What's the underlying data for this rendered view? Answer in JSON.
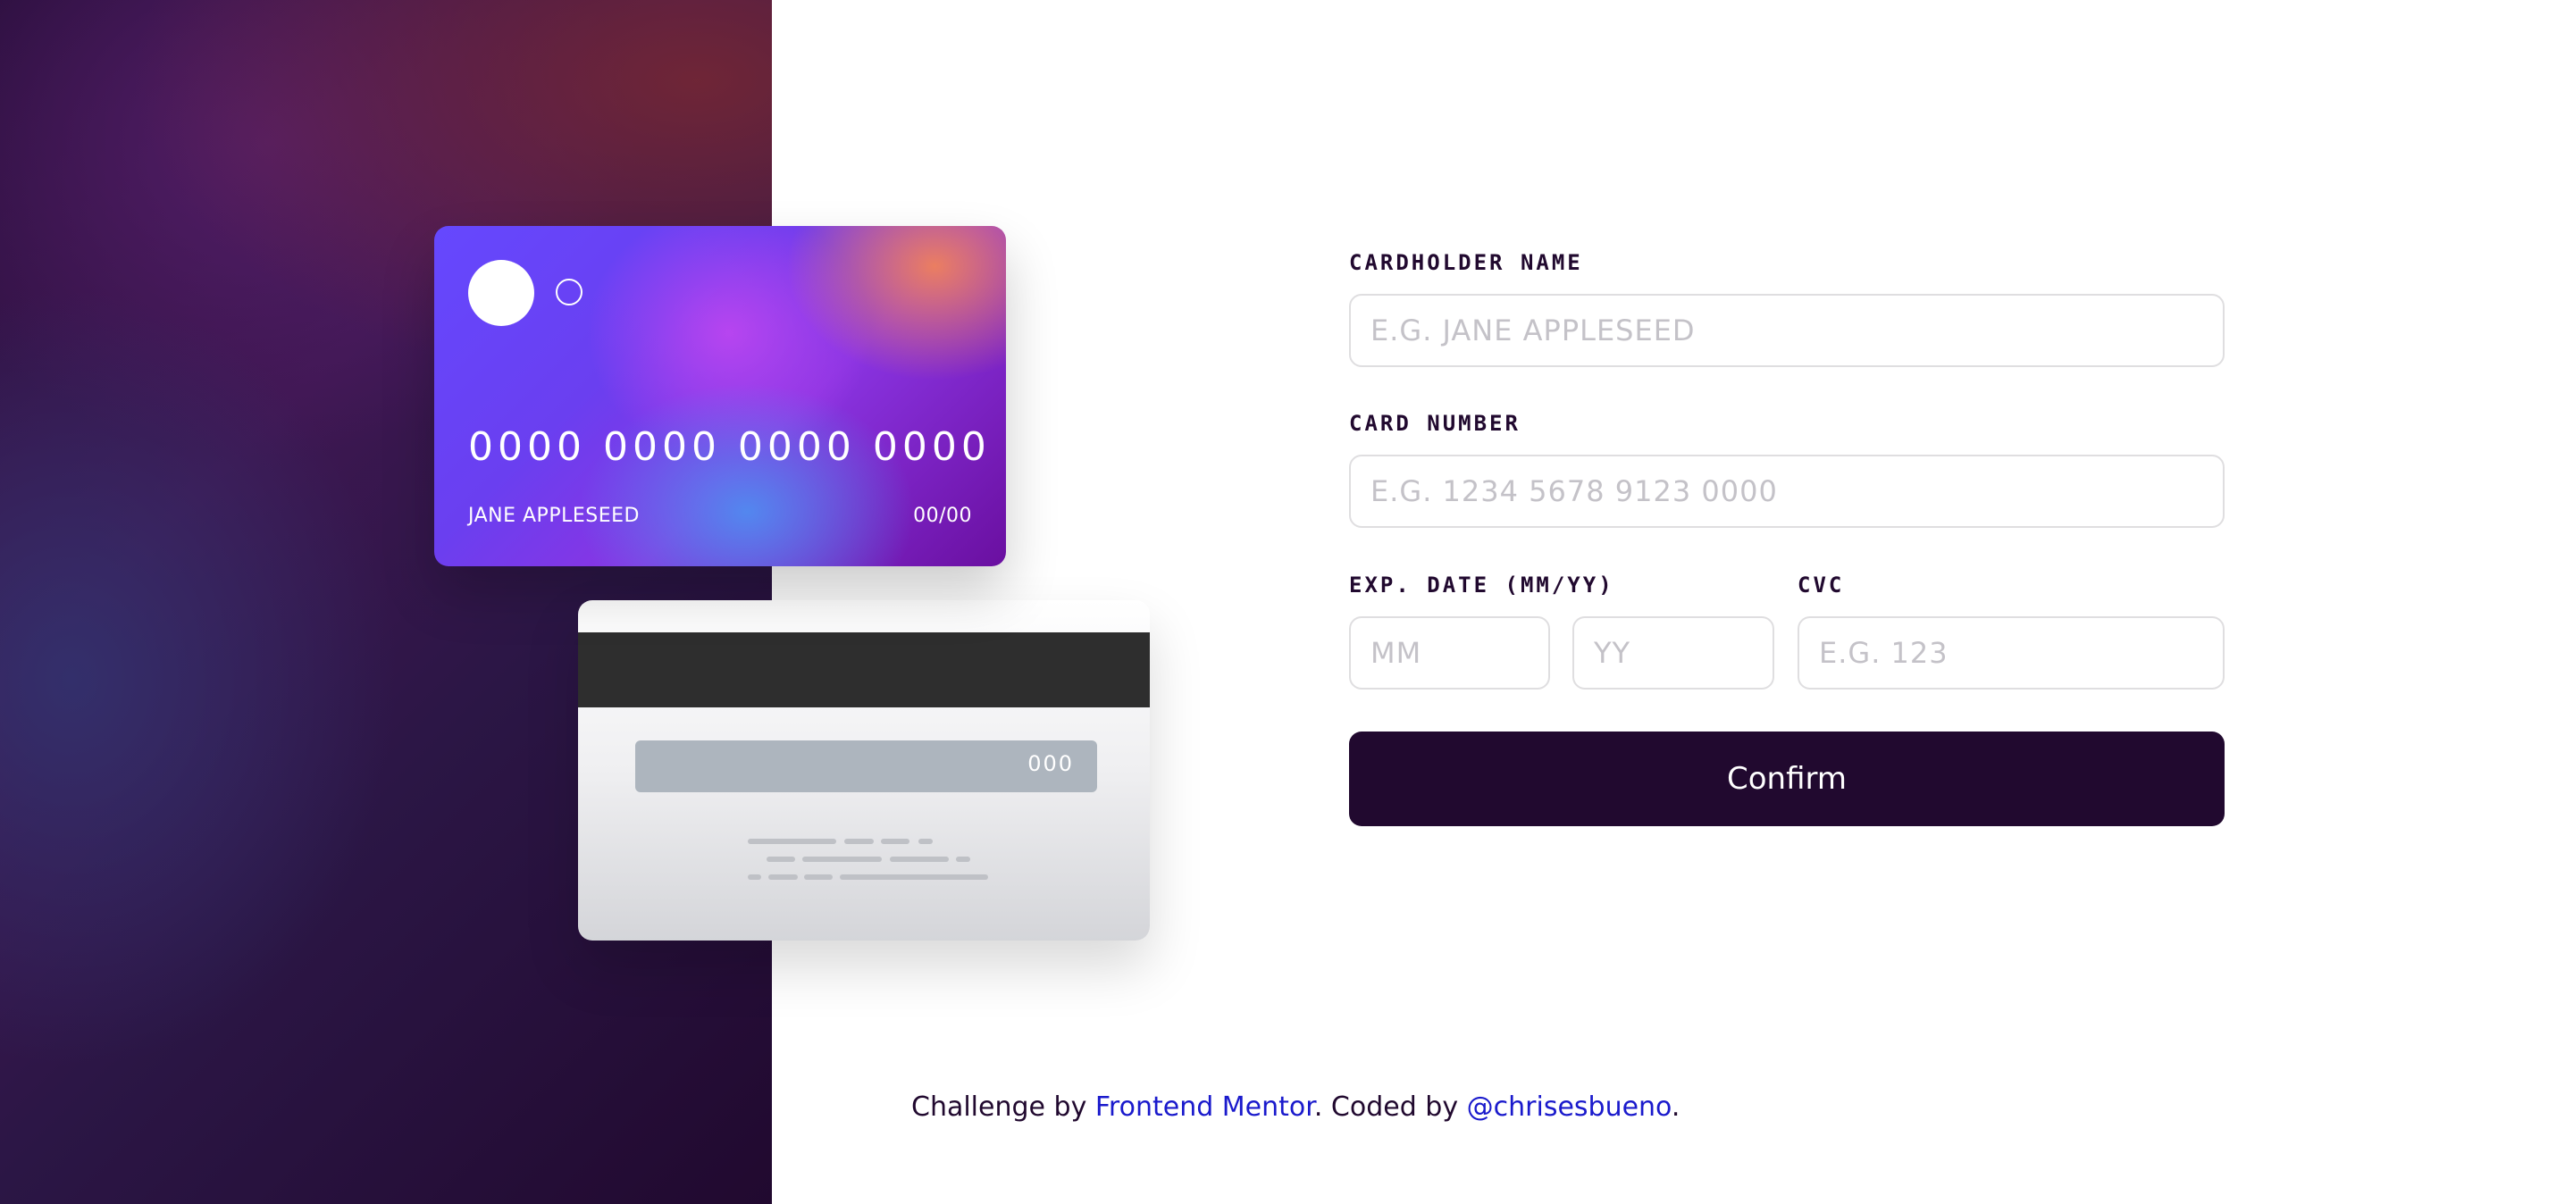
{
  "card_front": {
    "number": "0000 0000 0000 0000",
    "name": "JANE APPLESEED",
    "exp": "00/00"
  },
  "card_back": {
    "cvc": "000"
  },
  "form": {
    "cardholder_name": {
      "label": "CARDHOLDER NAME",
      "placeholder": "E.G. JANE APPLESEED"
    },
    "card_number": {
      "label": "CARD NUMBER",
      "placeholder": "E.G. 1234 5678 9123 0000"
    },
    "exp_date": {
      "label": "EXP. DATE (MM/YY)",
      "month_placeholder": "MM",
      "year_placeholder": "YY"
    },
    "cvc": {
      "label": "CVC",
      "placeholder": "E.G. 123"
    },
    "confirm_label": "Confirm"
  },
  "attribution": {
    "prefix": "Challenge by ",
    "frontend_mentor": "Frontend Mentor",
    "middle": ". Coded by ",
    "author": "@chrisesbueno",
    "suffix": "."
  },
  "colors": {
    "dark_violet": "#21092f",
    "link_blue": "#1a1acc",
    "input_border": "#dfdee0"
  }
}
